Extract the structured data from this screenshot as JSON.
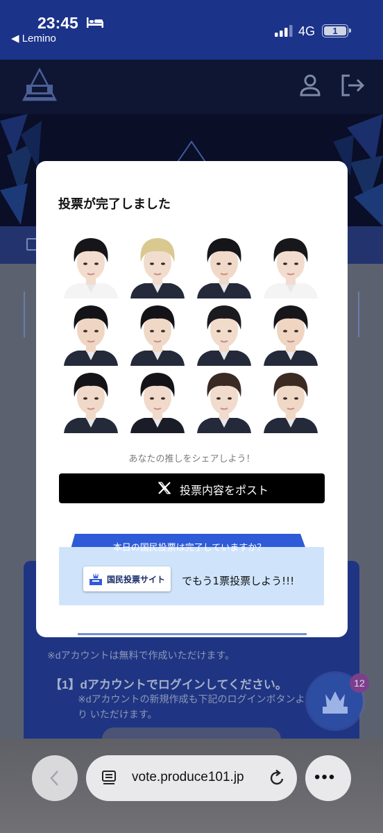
{
  "status_bar": {
    "time": "23:45",
    "back_app": "◀ Lemino",
    "network": "4G",
    "battery_label": "1"
  },
  "modal": {
    "title": "投票が完了しました",
    "share_caption": "あなたの推しをシェアしよう！",
    "post_button_label": "投票内容をポスト",
    "vote_question": "本日の国民投票は完了していますか？",
    "site_button_label": "国民投票サイト",
    "vote_cta": "でもう1票投票しよう!!!",
    "trainees": [
      {
        "hair": "#15151a",
        "skin": "#f2dccd",
        "jacket": "#f4f4f4"
      },
      {
        "hair": "#d9c98f",
        "skin": "#f1dccd",
        "jacket": "#242a3a"
      },
      {
        "hair": "#15151a",
        "skin": "#f0d9c8",
        "jacket": "#242a3a"
      },
      {
        "hair": "#17171c",
        "skin": "#f2dccd",
        "jacket": "#f4f4f4"
      },
      {
        "hair": "#141418",
        "skin": "#efd6c3",
        "jacket": "#242a3a"
      },
      {
        "hair": "#141418",
        "skin": "#f0d8c7",
        "jacket": "#242a3a"
      },
      {
        "hair": "#1a1a1f",
        "skin": "#f1dbcb",
        "jacket": "#242a3a"
      },
      {
        "hair": "#16161b",
        "skin": "#efd5c2",
        "jacket": "#242a3a"
      },
      {
        "hair": "#141418",
        "skin": "#f0d9c8",
        "jacket": "#242a3a"
      },
      {
        "hair": "#141418",
        "skin": "#f1dacb",
        "jacket": "#1a1d28"
      },
      {
        "hair": "#3a2a24",
        "skin": "#f1dbcc",
        "jacket": "#242a3a"
      },
      {
        "hair": "#3b2b22",
        "skin": "#f0d8c6",
        "jacket": "#242a3a"
      }
    ]
  },
  "background_page": {
    "note": "※dアカウントは無料で作成いただけます。",
    "step1": "【1】dアカウントでログインしてください。",
    "step1_sub": "※dアカウントの新規作成も下記のログインボタンより いただけます。",
    "badge_count": "12"
  },
  "browser": {
    "url": "vote.produce101.jp",
    "more_label": "•••"
  }
}
